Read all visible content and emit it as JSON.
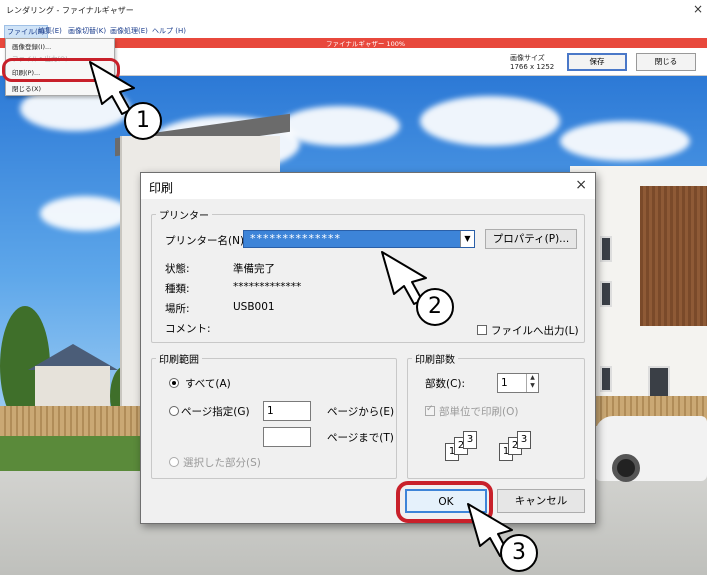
{
  "window": {
    "title": "レンダリング - ファイナルギャザー",
    "close_glyph": "×"
  },
  "menubar": [
    "ファイル(F)",
    "編集(E)",
    "画像切替(K)",
    "画像処理(E)",
    "ヘルプ (H)"
  ],
  "progress": {
    "text": "ファイナルギャザー 100%",
    "percent": 100
  },
  "toolbar": {
    "image_size_label": "画像サイズ",
    "image_size_value": "1766 x 1252",
    "save": "保存",
    "close": "閉じる"
  },
  "file_menu": [
    "画像登録(I)...",
    "ファイルへ出力(O)",
    "印刷(P)...",
    "閉じる(X)"
  ],
  "dialog": {
    "title": "印刷",
    "close_glyph": "×",
    "printer_group": "プリンター",
    "printer_name_label": "プリンター名(N):",
    "printer_name_value": "**************",
    "properties_button": "プロパティ(P)...",
    "status_label": "状態:",
    "status_value": "準備完了",
    "type_label": "種類:",
    "type_value": "*************",
    "where_label": "場所:",
    "where_value": "USB001",
    "comment_label": "コメント:",
    "print_to_file": "ファイルへ出力(L)",
    "range_group": "印刷範囲",
    "range_all": "すべて(A)",
    "range_pages": "ページ指定(G)",
    "range_from_value": "1",
    "range_from_label": "ページから(E)",
    "range_to_value": "",
    "range_to_label": "ページまで(T)",
    "range_selection": "選択した部分(S)",
    "copies_group": "印刷部数",
    "copies_label": "部数(C):",
    "copies_value": "1",
    "collate_label": "部単位で印刷(O)",
    "collate_pages": [
      "1",
      "2",
      "3"
    ],
    "ok": "OK",
    "cancel": "キャンセル"
  },
  "callouts": [
    "1",
    "2",
    "3"
  ],
  "colors": {
    "highlight": "#c8202a",
    "selection": "#3d84d8",
    "progress": "#e8483c"
  }
}
